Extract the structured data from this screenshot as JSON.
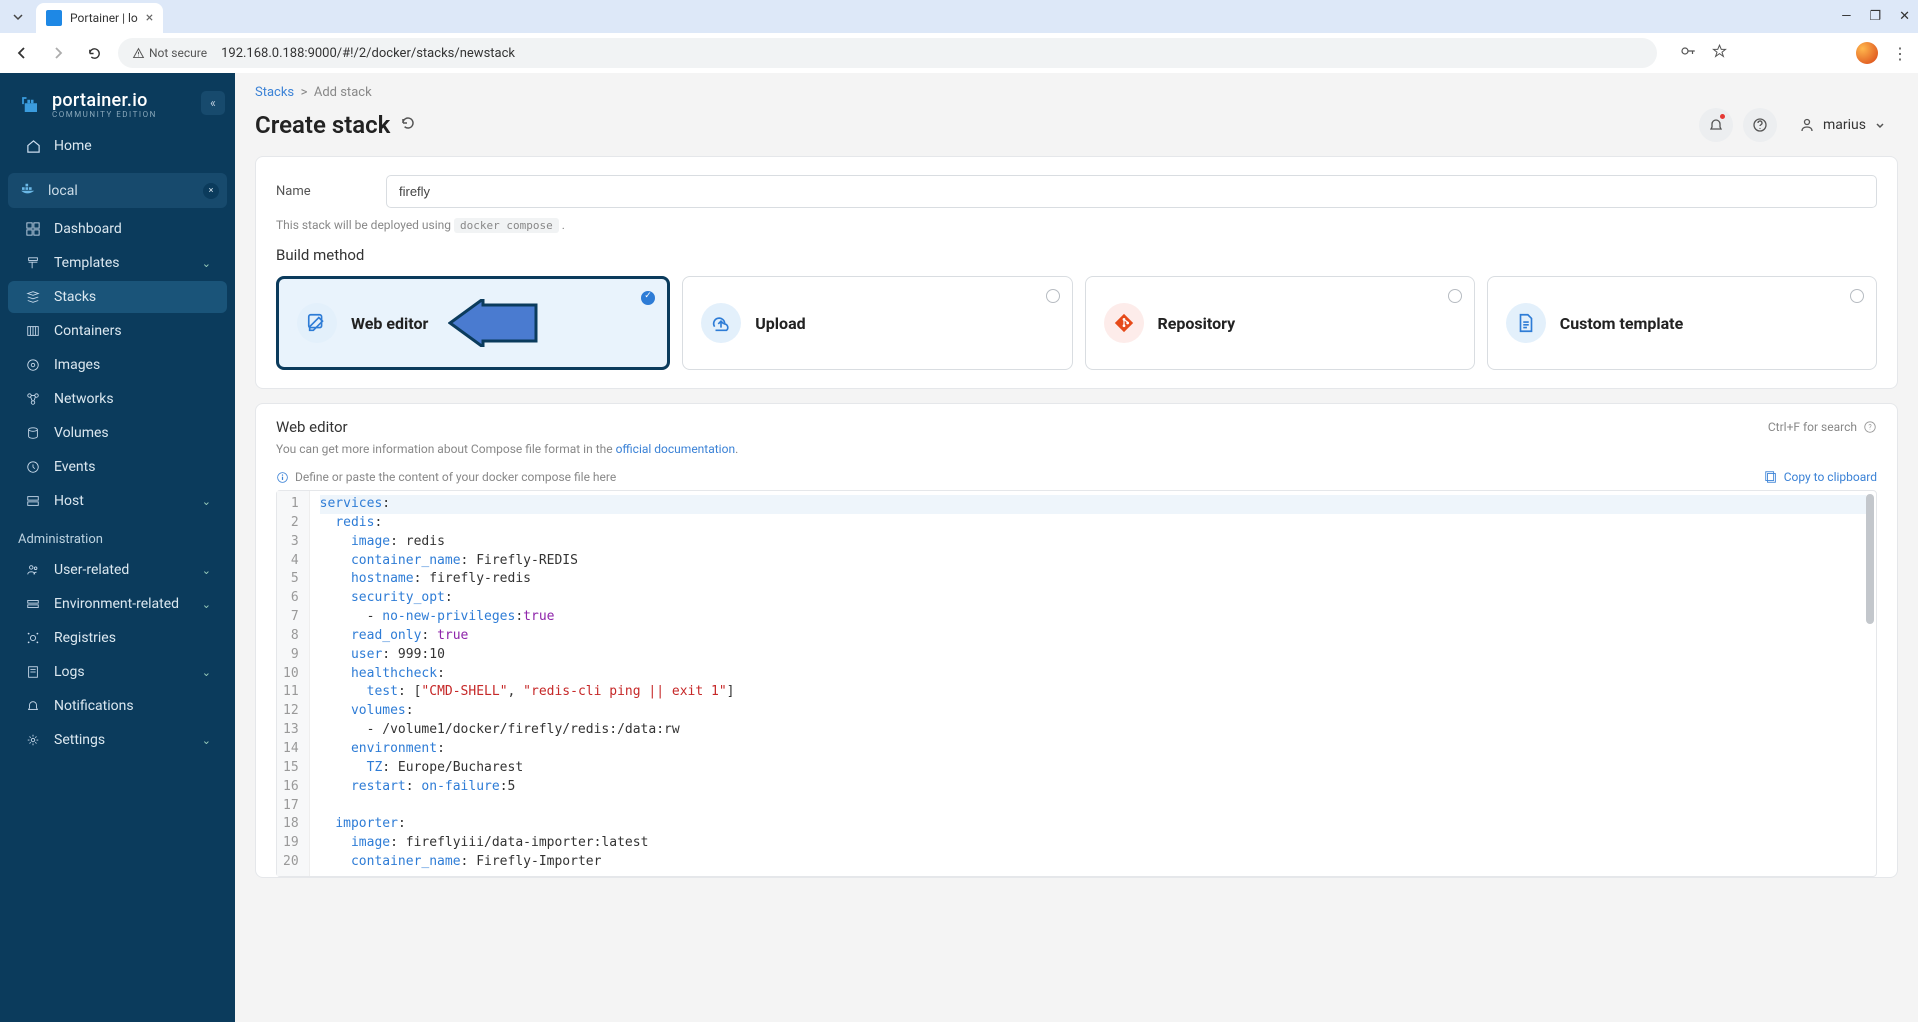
{
  "browser": {
    "tab_title": "Portainer | lo",
    "url": "192.168.0.188:9000/#!/2/docker/stacks/newstack",
    "secure_label": "Not secure"
  },
  "brand": {
    "name": "portainer.io",
    "edition": "COMMUNITY EDITION"
  },
  "sidebar": {
    "home": "Home",
    "env_label": "local",
    "items": [
      {
        "label": "Dashboard"
      },
      {
        "label": "Templates"
      },
      {
        "label": "Stacks"
      },
      {
        "label": "Containers"
      },
      {
        "label": "Images"
      },
      {
        "label": "Networks"
      },
      {
        "label": "Volumes"
      },
      {
        "label": "Events"
      },
      {
        "label": "Host"
      }
    ],
    "admin_label": "Administration",
    "admin_items": [
      {
        "label": "User-related"
      },
      {
        "label": "Environment-related"
      },
      {
        "label": "Registries"
      },
      {
        "label": "Logs"
      },
      {
        "label": "Notifications"
      },
      {
        "label": "Settings"
      }
    ]
  },
  "breadcrumb": {
    "root": "Stacks",
    "current": "Add stack"
  },
  "page_title": "Create stack",
  "user": "marius",
  "form": {
    "name_label": "Name",
    "name_value": "firefly",
    "deploy_hint_pre": "This stack will be deployed using",
    "deploy_hint_code": "docker compose",
    "build_method_label": "Build method",
    "methods": {
      "web_editor": "Web editor",
      "upload": "Upload",
      "repository": "Repository",
      "custom_template": "Custom template"
    }
  },
  "editor": {
    "title": "Web editor",
    "search_hint": "Ctrl+F for search",
    "info_pre": "You can get more information about Compose file format in the ",
    "info_link": "official documentation",
    "placeholder_hint": "Define or paste the content of your docker compose file here",
    "copy_label": "Copy to clipboard",
    "lines": [
      "services:",
      "  redis:",
      "    image: redis",
      "    container_name: Firefly-REDIS",
      "    hostname: firefly-redis",
      "    security_opt:",
      "      - no-new-privileges:true",
      "    read_only: true",
      "    user: 999:10",
      "    healthcheck:",
      "      test: [\"CMD-SHELL\", \"redis-cli ping || exit 1\"]",
      "    volumes:",
      "      - /volume1/docker/firefly/redis:/data:rw",
      "    environment:",
      "      TZ: Europe/Bucharest",
      "    restart: on-failure:5",
      "",
      "  importer:",
      "    image: fireflyiii/data-importer:latest",
      "    container_name: Firefly-Importer"
    ]
  }
}
